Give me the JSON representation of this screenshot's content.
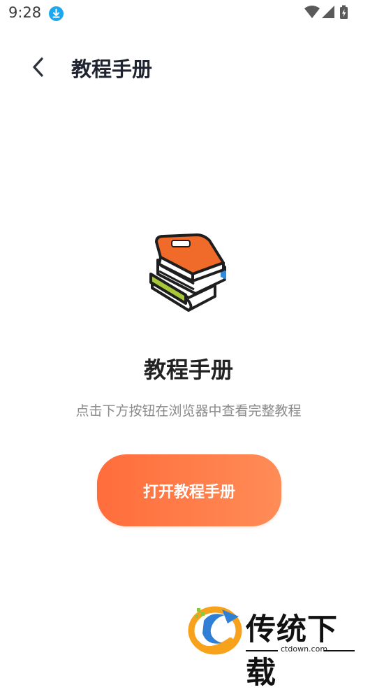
{
  "status_bar": {
    "time": "9:28",
    "download_icon": "download-icon",
    "icons": [
      "wifi-icon",
      "cellular-signal-icon",
      "battery-charging-icon"
    ]
  },
  "app_bar": {
    "back_icon": "chevron-left-icon",
    "title": "教程手册"
  },
  "main": {
    "illustration_icon": "books-stack-icon",
    "heading": "教程手册",
    "subtitle": "点击下方按钮在浏览器中查看完整教程",
    "open_button_label": "打开教程手册"
  },
  "watermark": {
    "brand_text": "传统下载",
    "url": "ctdown.com"
  },
  "colors": {
    "accent_start": "#ff6d3b",
    "accent_end": "#ff8c57",
    "book_orange": "#f06a2a",
    "book_green": "#a8c83a",
    "book_blue": "#2d8bd8",
    "download_badge": "#1aa8f0"
  }
}
